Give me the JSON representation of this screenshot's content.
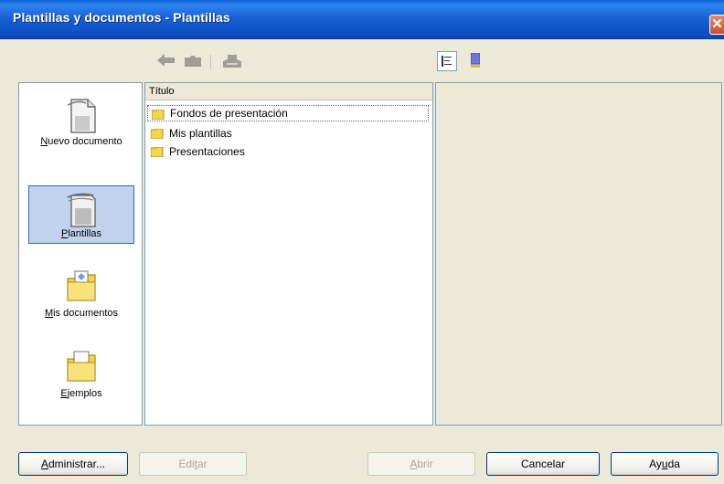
{
  "window": {
    "title": "Plantillas y documentos - Plantillas",
    "close_glyph": "✕"
  },
  "toolbar": {
    "back_icon": "arrow-left-icon",
    "folder_up_icon": "folder-icon",
    "print_icon": "printer-icon",
    "view_list_icon": "list-view-icon",
    "preview_icon": "document-preview-icon"
  },
  "nav": {
    "items": [
      {
        "label": "Nuevo documento",
        "accel": "N",
        "rest": "uevo documento",
        "icon": "new-document-icon",
        "selected": false
      },
      {
        "label": "Plantillas",
        "accel": "P",
        "rest": "lantillas",
        "icon": "templates-icon",
        "selected": true
      },
      {
        "label": "Mis documentos",
        "accel": "M",
        "rest": "is documentos",
        "icon": "my-documents-icon",
        "selected": false
      },
      {
        "label": "Ejemplos",
        "accel": "E",
        "rest": "jemplos",
        "icon": "examples-icon",
        "selected": false
      }
    ]
  },
  "list": {
    "header": "Título",
    "rows": [
      {
        "label": "Fondos de presentación",
        "focused": true
      },
      {
        "label": "Mis plantillas",
        "focused": false
      },
      {
        "label": "Presentaciones",
        "focused": false
      }
    ]
  },
  "buttons": {
    "administrar": {
      "pre": "",
      "accel": "A",
      "post": "dministrar..."
    },
    "editar": {
      "pre": "Edi",
      "accel": "t",
      "post": "ar"
    },
    "abrir": {
      "pre": "",
      "accel": "A",
      "post": "brir"
    },
    "cancelar": {
      "label": "Cancelar"
    },
    "ayuda": {
      "pre": "Ay",
      "accel": "u",
      "post": "da"
    }
  },
  "colors": {
    "titlebar": "#0f53c8",
    "selection": "#c1d2ee",
    "folder": "#f5d54a"
  }
}
